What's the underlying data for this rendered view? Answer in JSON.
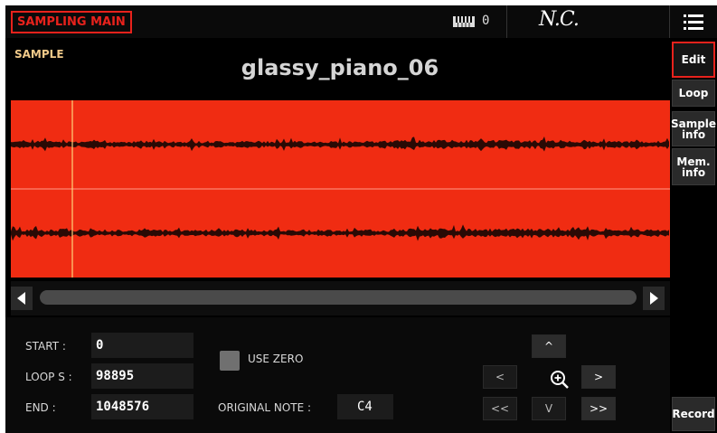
{
  "topbar": {
    "mode": "SAMPLING MAIN",
    "transpose": "0",
    "chord": "N.C.",
    "icons": [
      "keyboard-icon",
      "menu-icon"
    ]
  },
  "header": {
    "section_label": "SAMPLE",
    "sample_name": "glassy_piano_06"
  },
  "tabs": {
    "edit": "Edit",
    "loop": "Loop",
    "sample_info_1": "Sample",
    "sample_info_2": "info",
    "mem_info_1": "Mem.",
    "mem_info_2": "info",
    "record": "Record"
  },
  "params": {
    "start_label": "START :",
    "start_value": "0",
    "loop_label": "LOOP S :",
    "loop_value": "98895",
    "end_label": "END :",
    "end_value": "1048576",
    "use_zero_label": "USE ZERO",
    "original_note_label": "ORIGINAL NOTE :",
    "original_note_value": "C4"
  },
  "nav": {
    "up": "^",
    "left": "<",
    "right": ">",
    "fast_left": "<<",
    "down": "V",
    "fast_right": ">>"
  },
  "colors": {
    "accent": "#e8221c",
    "waveform_bg": "#f02c12",
    "section_label": "#f0c989"
  }
}
